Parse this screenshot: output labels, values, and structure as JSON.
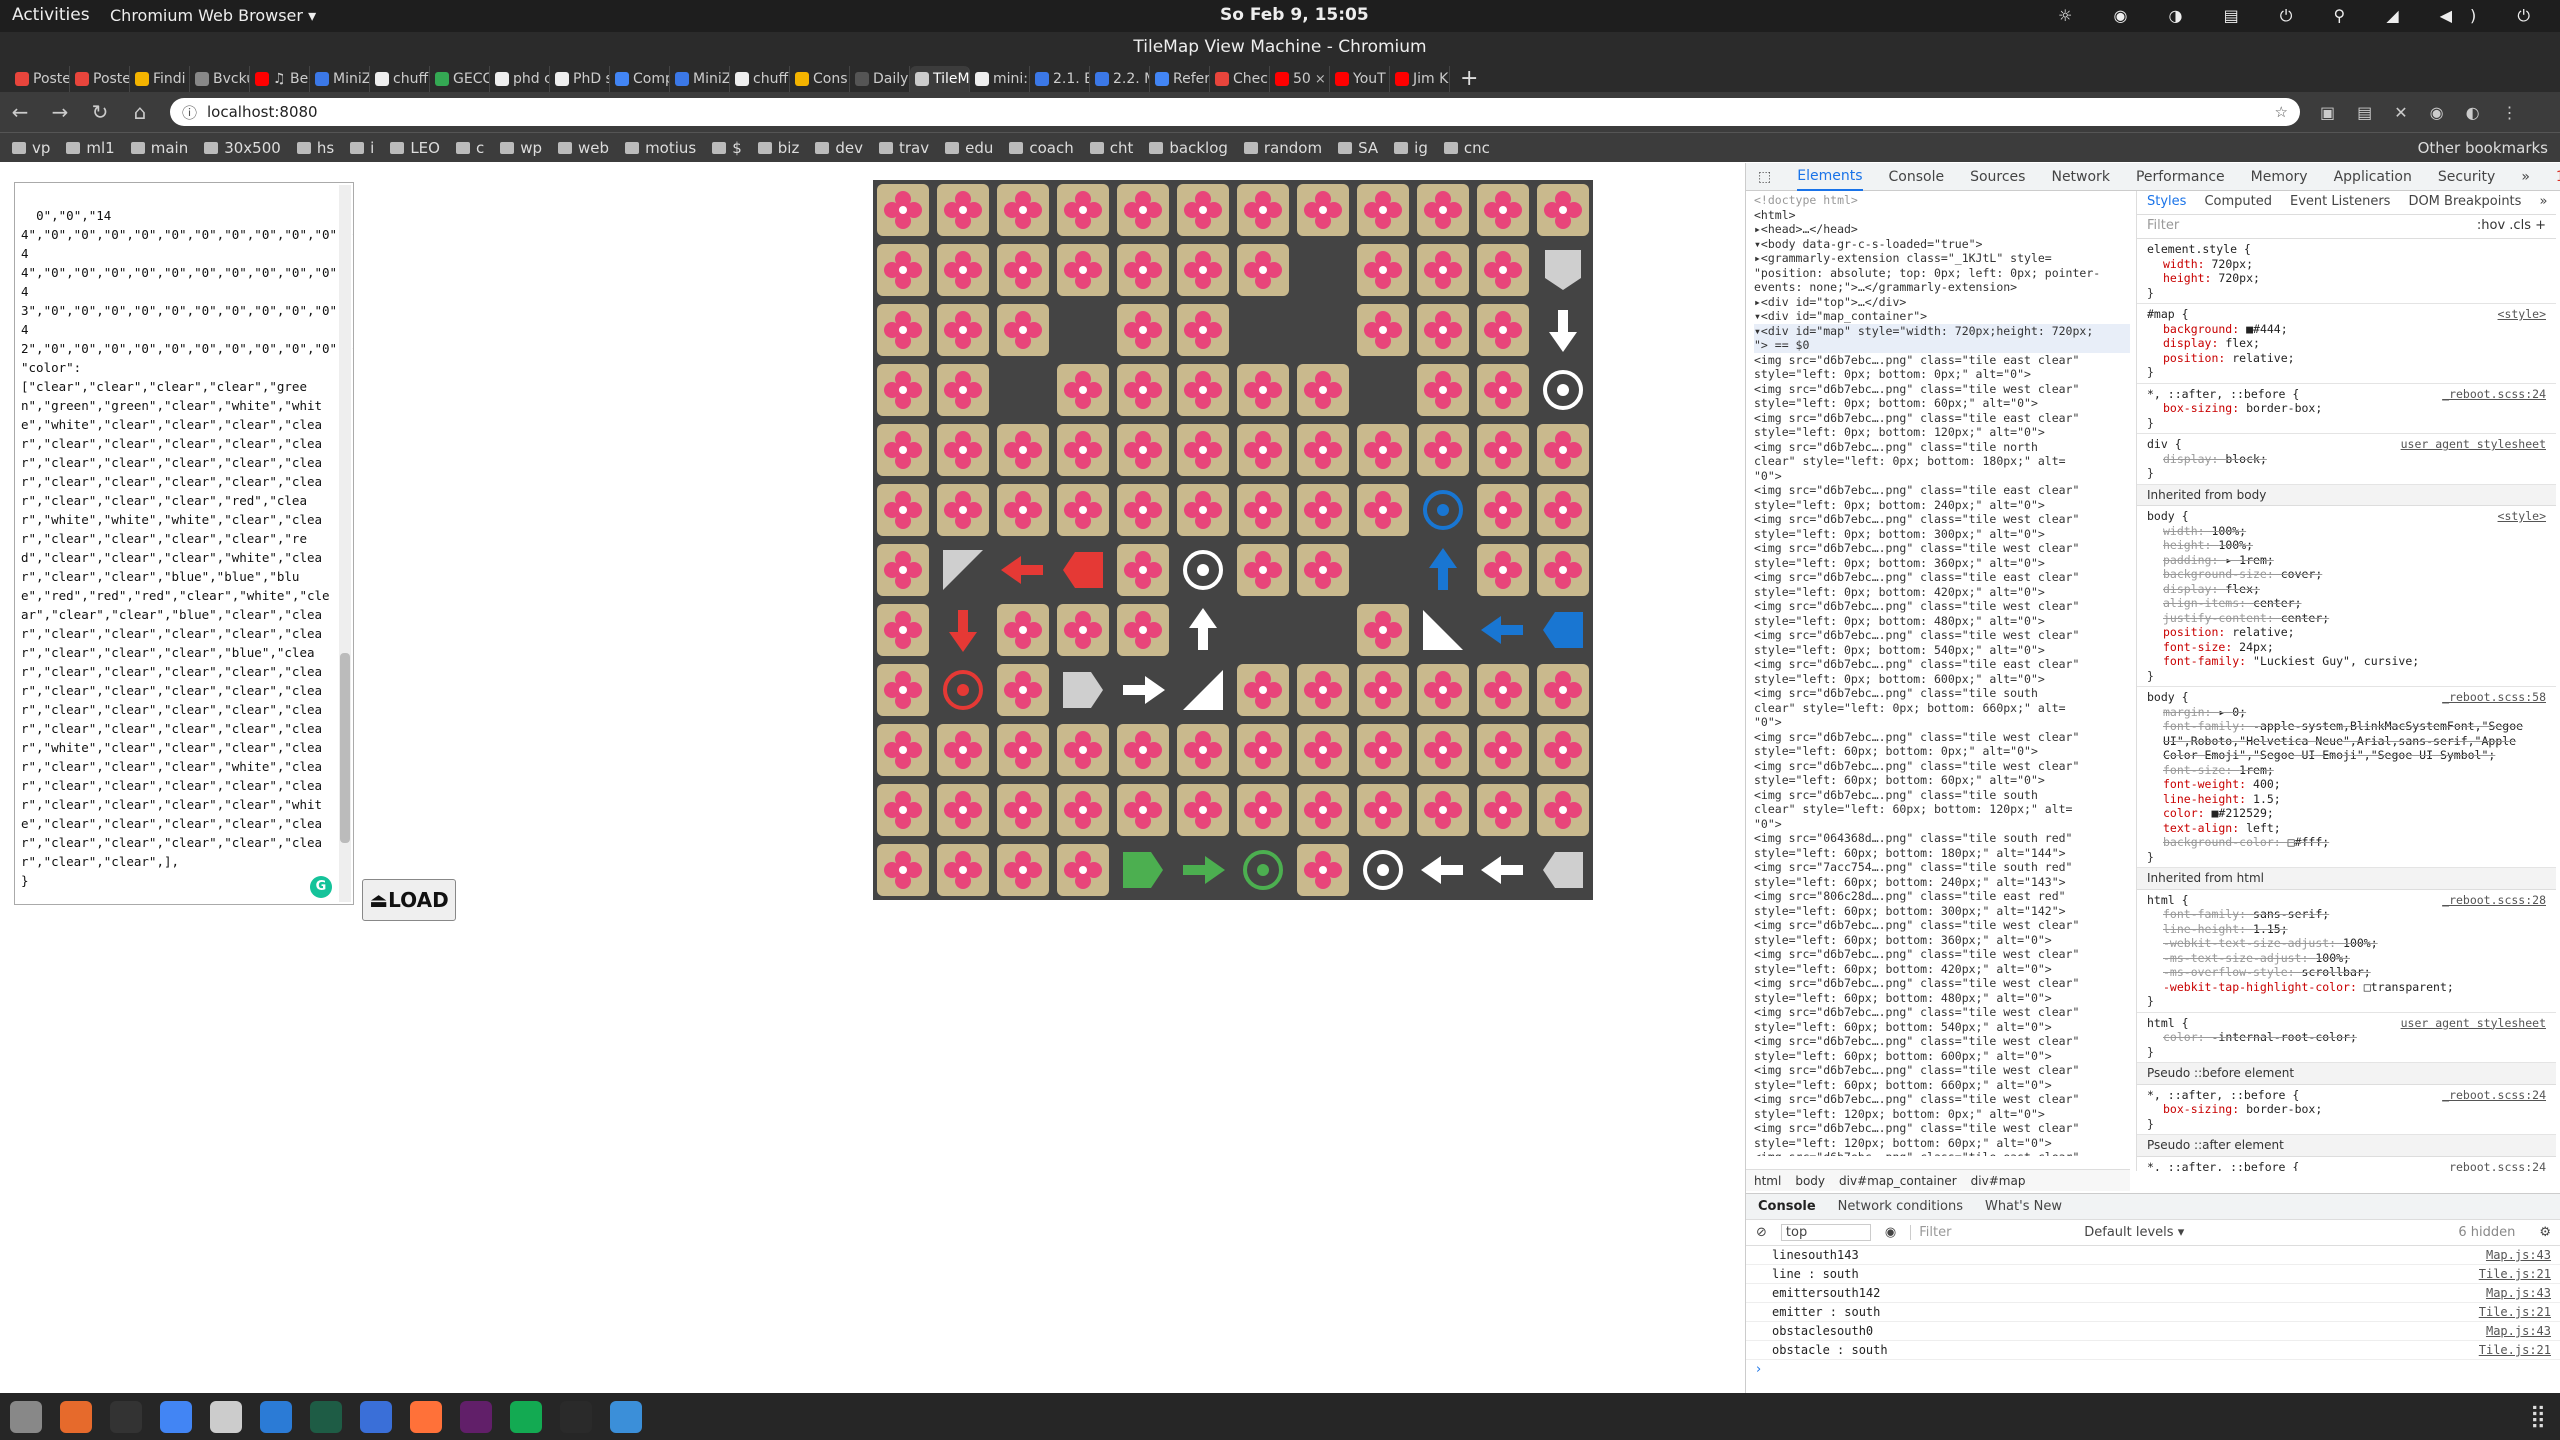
{
  "system_bar": {
    "activities": "Activities",
    "app_menu": "Chromium Web Browser ▾",
    "clock": "So Feb 9, 15:05",
    "tray": "☼ ◉ ◑ ▤ ⏻ ⚲ ◢ ◀) ⏻"
  },
  "window": {
    "title": "TileMap View Machine - Chromium"
  },
  "tabs": [
    {
      "label": "Poste",
      "color": "#e8453c",
      "active": false
    },
    {
      "label": "Poste",
      "color": "#e8453c",
      "active": false
    },
    {
      "label": "Findi",
      "color": "#f4b400",
      "active": false
    },
    {
      "label": "Bvcku",
      "color": "#888888",
      "active": false
    },
    {
      "label": "♫ Be",
      "color": "#ff0000",
      "active": false
    },
    {
      "label": "MiniZ",
      "color": "#3b78e7",
      "active": false
    },
    {
      "label": "chuff",
      "color": "#eeeeee",
      "active": false
    },
    {
      "label": "GECC",
      "color": "#34a853",
      "active": false
    },
    {
      "label": "phd c",
      "color": "#eeeeee",
      "active": false
    },
    {
      "label": "PhD s",
      "color": "#eeeeee",
      "active": false
    },
    {
      "label": "Comp",
      "color": "#4285f4",
      "active": false
    },
    {
      "label": "MiniZ",
      "color": "#3b78e7",
      "active": false
    },
    {
      "label": "chuff",
      "color": "#eeeeee",
      "active": false
    },
    {
      "label": "Cons",
      "color": "#f4b400",
      "active": false
    },
    {
      "label": "Daily",
      "color": "#555555",
      "active": false
    },
    {
      "label": "TileM",
      "color": "#cccccc",
      "active": true
    },
    {
      "label": "mini:",
      "color": "#eeeeee",
      "active": false
    },
    {
      "label": "2.1. E",
      "color": "#3b78e7",
      "active": false
    },
    {
      "label": "2.2. M",
      "color": "#3b78e7",
      "active": false
    },
    {
      "label": "Refer",
      "color": "#4285f4",
      "active": false
    },
    {
      "label": "Check",
      "color": "#e8453c",
      "active": false
    },
    {
      "label": "50",
      "color": "#ff0000",
      "active": false
    },
    {
      "label": "YouT",
      "color": "#ff0000",
      "active": false
    },
    {
      "label": "Jim K",
      "color": "#ff0000",
      "active": false
    }
  ],
  "omnibox": {
    "url": "localhost:8080"
  },
  "bookmarks": [
    "vp",
    "ml1",
    "main",
    "30x500",
    "hs",
    "i",
    "LEO",
    "c",
    "wp",
    "web",
    "motius",
    "$",
    "biz",
    "dev",
    "trav",
    "edu",
    "coach",
    "cht",
    "backlog",
    "random",
    "SA",
    "ig",
    "cnc"
  ],
  "bookmarks_other": "Other bookmarks",
  "json_text": "0\",\"0\",\"144\",\"0\",\"0\",\"0\",\"0\",\"0\",\"0\",\"0\",\"0\",\"0\",\"0\",\"0\",\"0\",\"0\",\"0\",\"0\",\"0\",\"0\",\"0\",\"0\",\"0\",\"0\",\"0\",\"144\",\"0\",\"0\",\"0\",\"0\",\"0\",\"0\",\"0\",\"0\",\"0\",\"0\",\"143\",\"0\",\"0\",\"0\",\"0\",\"0\",\"0\",\"0\",\"0\",\"0\",\"0\",\"142\",\"0\",\"0\",\"0\",\"0\",\"0\",\"0\",\"0\",\"0\",\"0\",\"0\",\"0\",],\n\"color\":\n[\"clear\",\"clear\",\"clear\",\"clear\",\"green\",\"green\",\"green\",\"clear\",\"white\",\"white\",\"white\",\"clear\",\"clear\",\"clear\",\"clear\",\"clear\",\"clear\",\"clear\",\"clear\",\"clear\",\"clear\",\"clear\",\"clear\",\"clear\",\"clear\",\"clear\",\"clear\",\"clear\",\"clear\",\"clear\",\"clear\",\"clear\",\"clear\",\"red\",\"clear\",\"white\",\"white\",\"white\",\"clear\",\"clear\",\"clear\",\"clear\",\"clear\",\"clear\",\"red\",\"clear\",\"clear\",\"clear\",\"white\",\"clear\",\"clear\",\"clear\",\"blue\",\"blue\",\"blue\",\"red\",\"red\",\"red\",\"clear\",\"white\",\"clear\",\"clear\",\"clear\",\"blue\",\"clear\",\"clear\",\"clear\",\"clear\",\"clear\",\"clear\",\"clear\",\"clear\",\"clear\",\"clear\",\"blue\",\"clear\",\"clear\",\"clear\",\"clear\",\"clear\",\"clear\",\"clear\",\"clear\",\"clear\",\"clear\",\"clear\",\"clear\",\"clear\",\"clear\",\"clear\",\"clear\",\"clear\",\"clear\",\"clear\",\"clear\",\"clear\",\"white\",\"clear\",\"clear\",\"clear\",\"clear\",\"clear\",\"clear\",\"clear\",\"white\",\"clear\",\"clear\",\"clear\",\"clear\",\"clear\",\"clear\",\"clear\",\"clear\",\"clear\",\"clear\",\"white\",\"clear\",\"clear\",\"clear\",\"clear\",\"clear\",\"clear\",\"clear\",\"clear\",\"clear\",\"clear\",\"clear\",\"clear\",],\n}",
  "load_button": "⏏LOAD",
  "map": {
    "colors": {
      "flower": "#e8457a",
      "tile": "#c9b98d",
      "bg": "#444444",
      "red": "#e53935",
      "blue": "#1976d2",
      "green": "#4caf50",
      "white": "#ffffff",
      "gray": "#cfcfcf"
    },
    "rows": [
      [
        "f",
        "f",
        "f",
        "f",
        "f",
        "f",
        "f",
        "f",
        "f",
        "f",
        "f",
        "f"
      ],
      [
        "f",
        "f",
        "f",
        "f",
        "f",
        "f",
        "f",
        "_",
        "f",
        "f",
        "f",
        "gray-emitter-down"
      ],
      [
        "f",
        "f",
        "f",
        "_",
        "f",
        "f",
        "_",
        "_",
        "f",
        "f",
        "f",
        "white-arrow-down"
      ],
      [
        "f",
        "f",
        "_",
        "f",
        "f",
        "f",
        "f",
        "f",
        "_",
        "f",
        "f",
        "white-target"
      ],
      [
        "f",
        "f",
        "f",
        "f",
        "f",
        "f",
        "f",
        "f",
        "f",
        "f",
        "f",
        "f"
      ],
      [
        "f",
        "f",
        "f",
        "f",
        "f",
        "f",
        "f",
        "f",
        "f",
        "blue-target",
        "f",
        "f"
      ],
      [
        "f",
        "gray-corner",
        "red-arrow-left",
        "red-emitter-left",
        "f",
        "white-target",
        "f",
        "f",
        "_",
        "blue-arrow-up",
        "f",
        "f"
      ],
      [
        "f",
        "red-arrow-down",
        "f",
        "f",
        "f",
        "white-arrow-up",
        "_",
        "_",
        "f",
        "white-corner-b",
        "blue-arrow-left",
        "blue-emitter-left"
      ],
      [
        "f",
        "red-target",
        "f",
        "gray-emitter-right",
        "white-arrow-right",
        "white-corner-a",
        "f",
        "f",
        "f",
        "f",
        "f",
        "f"
      ],
      [
        "f",
        "f",
        "f",
        "f",
        "f",
        "f",
        "f",
        "f",
        "f",
        "f",
        "f",
        "f"
      ],
      [
        "f",
        "f",
        "f",
        "f",
        "f",
        "f",
        "f",
        "f",
        "f",
        "f",
        "f",
        "f"
      ],
      [
        "f",
        "f",
        "f",
        "f",
        "green-emitter-right",
        "green-arrow-right",
        "green-target",
        "f",
        "white-target",
        "white-arrow-left",
        "white-arrow-left",
        "gray-emitter-left"
      ]
    ]
  },
  "devtools": {
    "tabs": [
      "Elements",
      "Console",
      "Sources",
      "Network",
      "Performance",
      "Memory",
      "Application",
      "Security",
      "»"
    ],
    "active_tab": "Elements",
    "errors": "1",
    "elements_lines": [
      "<!doctype html>",
      "<html>",
      "▸<head>…</head>",
      "▾<body data-gr-c-s-loaded=\"true\">",
      "  ▸<grammarly-extension class=\"_1KJtL\" style=",
      "   \"position: absolute; top: 0px; left: 0px; pointer-",
      "   events: none;\">…</grammarly-extension>",
      "  ▸<div id=\"top\">…</div>",
      "  ▾<div id=\"map_container\">",
      "    ▾<div id=\"map\" style=\"width: 720px;height: 720px;",
      "     \"> == $0",
      "       <img src=\"d6b7ebc….png\" class=\"tile east clear\"",
      "       style=\"left: 0px; bottom: 0px;\" alt=\"0\">",
      "       <img src=\"d6b7ebc….png\" class=\"tile west clear\"",
      "       style=\"left: 0px; bottom: 60px;\" alt=\"0\">",
      "       <img src=\"d6b7ebc….png\" class=\"tile east clear\"",
      "       style=\"left: 0px; bottom: 120px;\" alt=\"0\">",
      "       <img src=\"d6b7ebc….png\" class=\"tile north",
      "       clear\" style=\"left: 0px; bottom: 180px;\" alt=",
      "       \"0\">",
      "       <img src=\"d6b7ebc….png\" class=\"tile east clear\"",
      "       style=\"left: 0px; bottom: 240px;\" alt=\"0\">",
      "       <img src=\"d6b7ebc….png\" class=\"tile west clear\"",
      "       style=\"left: 0px; bottom: 300px;\" alt=\"0\">",
      "       <img src=\"d6b7ebc….png\" class=\"tile west clear\"",
      "       style=\"left: 0px; bottom: 360px;\" alt=\"0\">",
      "       <img src=\"d6b7ebc….png\" class=\"tile east clear\"",
      "       style=\"left: 0px; bottom: 420px;\" alt=\"0\">",
      "       <img src=\"d6b7ebc….png\" class=\"tile west clear\"",
      "       style=\"left: 0px; bottom: 480px;\" alt=\"0\">",
      "       <img src=\"d6b7ebc….png\" class=\"tile west clear\"",
      "       style=\"left: 0px; bottom: 540px;\" alt=\"0\">",
      "       <img src=\"d6b7ebc….png\" class=\"tile east clear\"",
      "       style=\"left: 0px; bottom: 600px;\" alt=\"0\">",
      "       <img src=\"d6b7ebc….png\" class=\"tile south",
      "       clear\" style=\"left: 0px; bottom: 660px;\" alt=",
      "       \"0\">",
      "       <img src=\"d6b7ebc….png\" class=\"tile west clear\"",
      "       style=\"left: 60px; bottom: 0px;\" alt=\"0\">",
      "       <img src=\"d6b7ebc….png\" class=\"tile west clear\"",
      "       style=\"left: 60px; bottom: 60px;\" alt=\"0\">",
      "       <img src=\"d6b7ebc….png\" class=\"tile south",
      "       clear\" style=\"left: 60px; bottom: 120px;\" alt=",
      "       \"0\">",
      "       <img src=\"064368d….png\" class=\"tile south red\"",
      "       style=\"left: 60px; bottom: 180px;\" alt=\"144\">",
      "       <img src=\"7acc754….png\" class=\"tile south red\"",
      "       style=\"left: 60px; bottom: 240px;\" alt=\"143\">",
      "       <img src=\"806c28d….png\" class=\"tile east red\"",
      "       style=\"left: 60px; bottom: 300px;\" alt=\"142\">",
      "       <img src=\"d6b7ebc….png\" class=\"tile west clear\"",
      "       style=\"left: 60px; bottom: 360px;\" alt=\"0\">",
      "       <img src=\"d6b7ebc….png\" class=\"tile west clear\"",
      "       style=\"left: 60px; bottom: 420px;\" alt=\"0\">",
      "       <img src=\"d6b7ebc….png\" class=\"tile west clear\"",
      "       style=\"left: 60px; bottom: 480px;\" alt=\"0\">",
      "       <img src=\"d6b7ebc….png\" class=\"tile west clear\"",
      "       style=\"left: 60px; bottom: 540px;\" alt=\"0\">",
      "       <img src=\"d6b7ebc….png\" class=\"tile west clear\"",
      "       style=\"left: 60px; bottom: 600px;\" alt=\"0\">",
      "       <img src=\"d6b7ebc….png\" class=\"tile west clear\"",
      "       style=\"left: 60px; bottom: 660px;\" alt=\"0\">",
      "       <img src=\"d6b7ebc….png\" class=\"tile west clear\"",
      "       style=\"left: 120px; bottom: 0px;\" alt=\"0\">",
      "       <img src=\"d6b7ebc….png\" class=\"tile west clear\"",
      "       style=\"left: 120px; bottom: 60px;\" alt=\"0\">",
      "       <img src=\"d6b7ebc….png\" class=\"tile east clear\""
    ],
    "breadcrumbs": [
      "html",
      "body",
      "div#map_container",
      "div#map"
    ],
    "styles_tabs": [
      "Styles",
      "Computed",
      "Event Listeners",
      "DOM Breakpoints",
      "»"
    ],
    "styles_filter": "Filter",
    "styles_filter_right": ":hov  .cls  +",
    "rules": [
      {
        "selector": "element.style {",
        "source": "",
        "props": [
          [
            "width",
            "720px;",
            false
          ],
          [
            "height",
            "720px;",
            false
          ]
        ]
      },
      {
        "selector": "#map {",
        "source": "<style>",
        "props": [
          [
            "background",
            "■#444;",
            false
          ],
          [
            "display",
            "flex;",
            false
          ],
          [
            "position",
            "relative;",
            false
          ]
        ]
      },
      {
        "selector": "*, ::after, ::before {",
        "source": "_reboot.scss:24",
        "props": [
          [
            "box-sizing",
            "border-box;",
            false
          ]
        ]
      },
      {
        "selector": "div {",
        "source": "user agent stylesheet",
        "props": [
          [
            "display",
            "block;",
            true
          ]
        ]
      }
    ],
    "inherited_body_label": "Inherited from body",
    "body_rules": [
      {
        "selector": "body {",
        "source": "<style>",
        "props": [
          [
            "width",
            "100%;",
            true
          ],
          [
            "height",
            "100%;",
            true
          ],
          [
            "padding",
            "▸ 1rem;",
            true
          ],
          [
            "background-size",
            "cover;",
            true
          ],
          [
            "display",
            "flex;",
            true
          ],
          [
            "align-items",
            "center;",
            true
          ],
          [
            "justify-content",
            "center;",
            true
          ],
          [
            "position",
            "relative;",
            false
          ],
          [
            "font-size",
            "24px;",
            false
          ],
          [
            "font-family",
            "\"Luckiest Guy\", cursive;",
            false
          ]
        ]
      },
      {
        "selector": "body {",
        "source": "_reboot.scss:58",
        "props": [
          [
            "margin",
            "▸ 0;",
            true
          ],
          [
            "font-family",
            "-apple-system,BlinkMacSystemFont,\"Segoe UI\",Roboto,\"Helvetica Neue\",Arial,sans-serif,\"Apple Color Emoji\",\"Segoe UI Emoji\",\"Segoe UI Symbol\";",
            true
          ],
          [
            "font-size",
            "1rem;",
            true
          ],
          [
            "font-weight",
            "400;",
            false
          ],
          [
            "line-height",
            "1.5;",
            false
          ],
          [
            "color",
            "■#212529;",
            false
          ],
          [
            "text-align",
            "left;",
            false
          ],
          [
            "background-color",
            "□#fff;",
            true
          ]
        ]
      }
    ],
    "inherited_html_label": "Inherited from html",
    "html_rules": [
      {
        "selector": "html {",
        "source": "_reboot.scss:28",
        "props": [
          [
            "font-family",
            "sans-serif;",
            true
          ],
          [
            "line-height",
            "1.15;",
            true
          ],
          [
            "-webkit-text-size-adjust",
            "100%;",
            true
          ],
          [
            "-ms-text-size-adjust",
            "100%;",
            true
          ],
          [
            "-ms-overflow-style",
            "scrollbar;",
            true
          ],
          [
            "-webkit-tap-highlight-color",
            "□transparent;",
            false
          ]
        ]
      },
      {
        "selector": "html {",
        "source": "user agent stylesheet",
        "props": [
          [
            "color",
            "-internal-root-color;",
            true
          ]
        ]
      }
    ],
    "pseudo_before_label": "Pseudo ::before element",
    "pseudo_after_label": "Pseudo ::after element",
    "pseudo_rule": {
      "selector": "*, ::after, ::before {",
      "source": "_reboot.scss:24",
      "props": [
        [
          "box-sizing",
          "border-box;",
          false
        ]
      ]
    },
    "console_tabs": [
      "Console",
      "Network conditions",
      "What's New"
    ],
    "console_context": "top",
    "console_filter": "Filter",
    "console_levels": "Default levels ▾",
    "console_hidden": "6 hidden",
    "console_lines": [
      {
        "text": "linesouth143",
        "src": "Map.js:43"
      },
      {
        "text": "line : south",
        "src": "Tile.js:21"
      },
      {
        "text": "emittersouth142",
        "src": "Map.js:43"
      },
      {
        "text": "emitter : south",
        "src": "Tile.js:21"
      },
      {
        "text": "obstaclesouth0",
        "src": "Map.js:43"
      },
      {
        "text": "obstacle : south",
        "src": "Tile.js:21"
      }
    ]
  },
  "taskbar": [
    "files",
    "software",
    "terminal",
    "chromium",
    "app",
    "vscode",
    "app2",
    "help",
    "firefox",
    "slack",
    "mongo",
    "zn",
    "qb"
  ]
}
